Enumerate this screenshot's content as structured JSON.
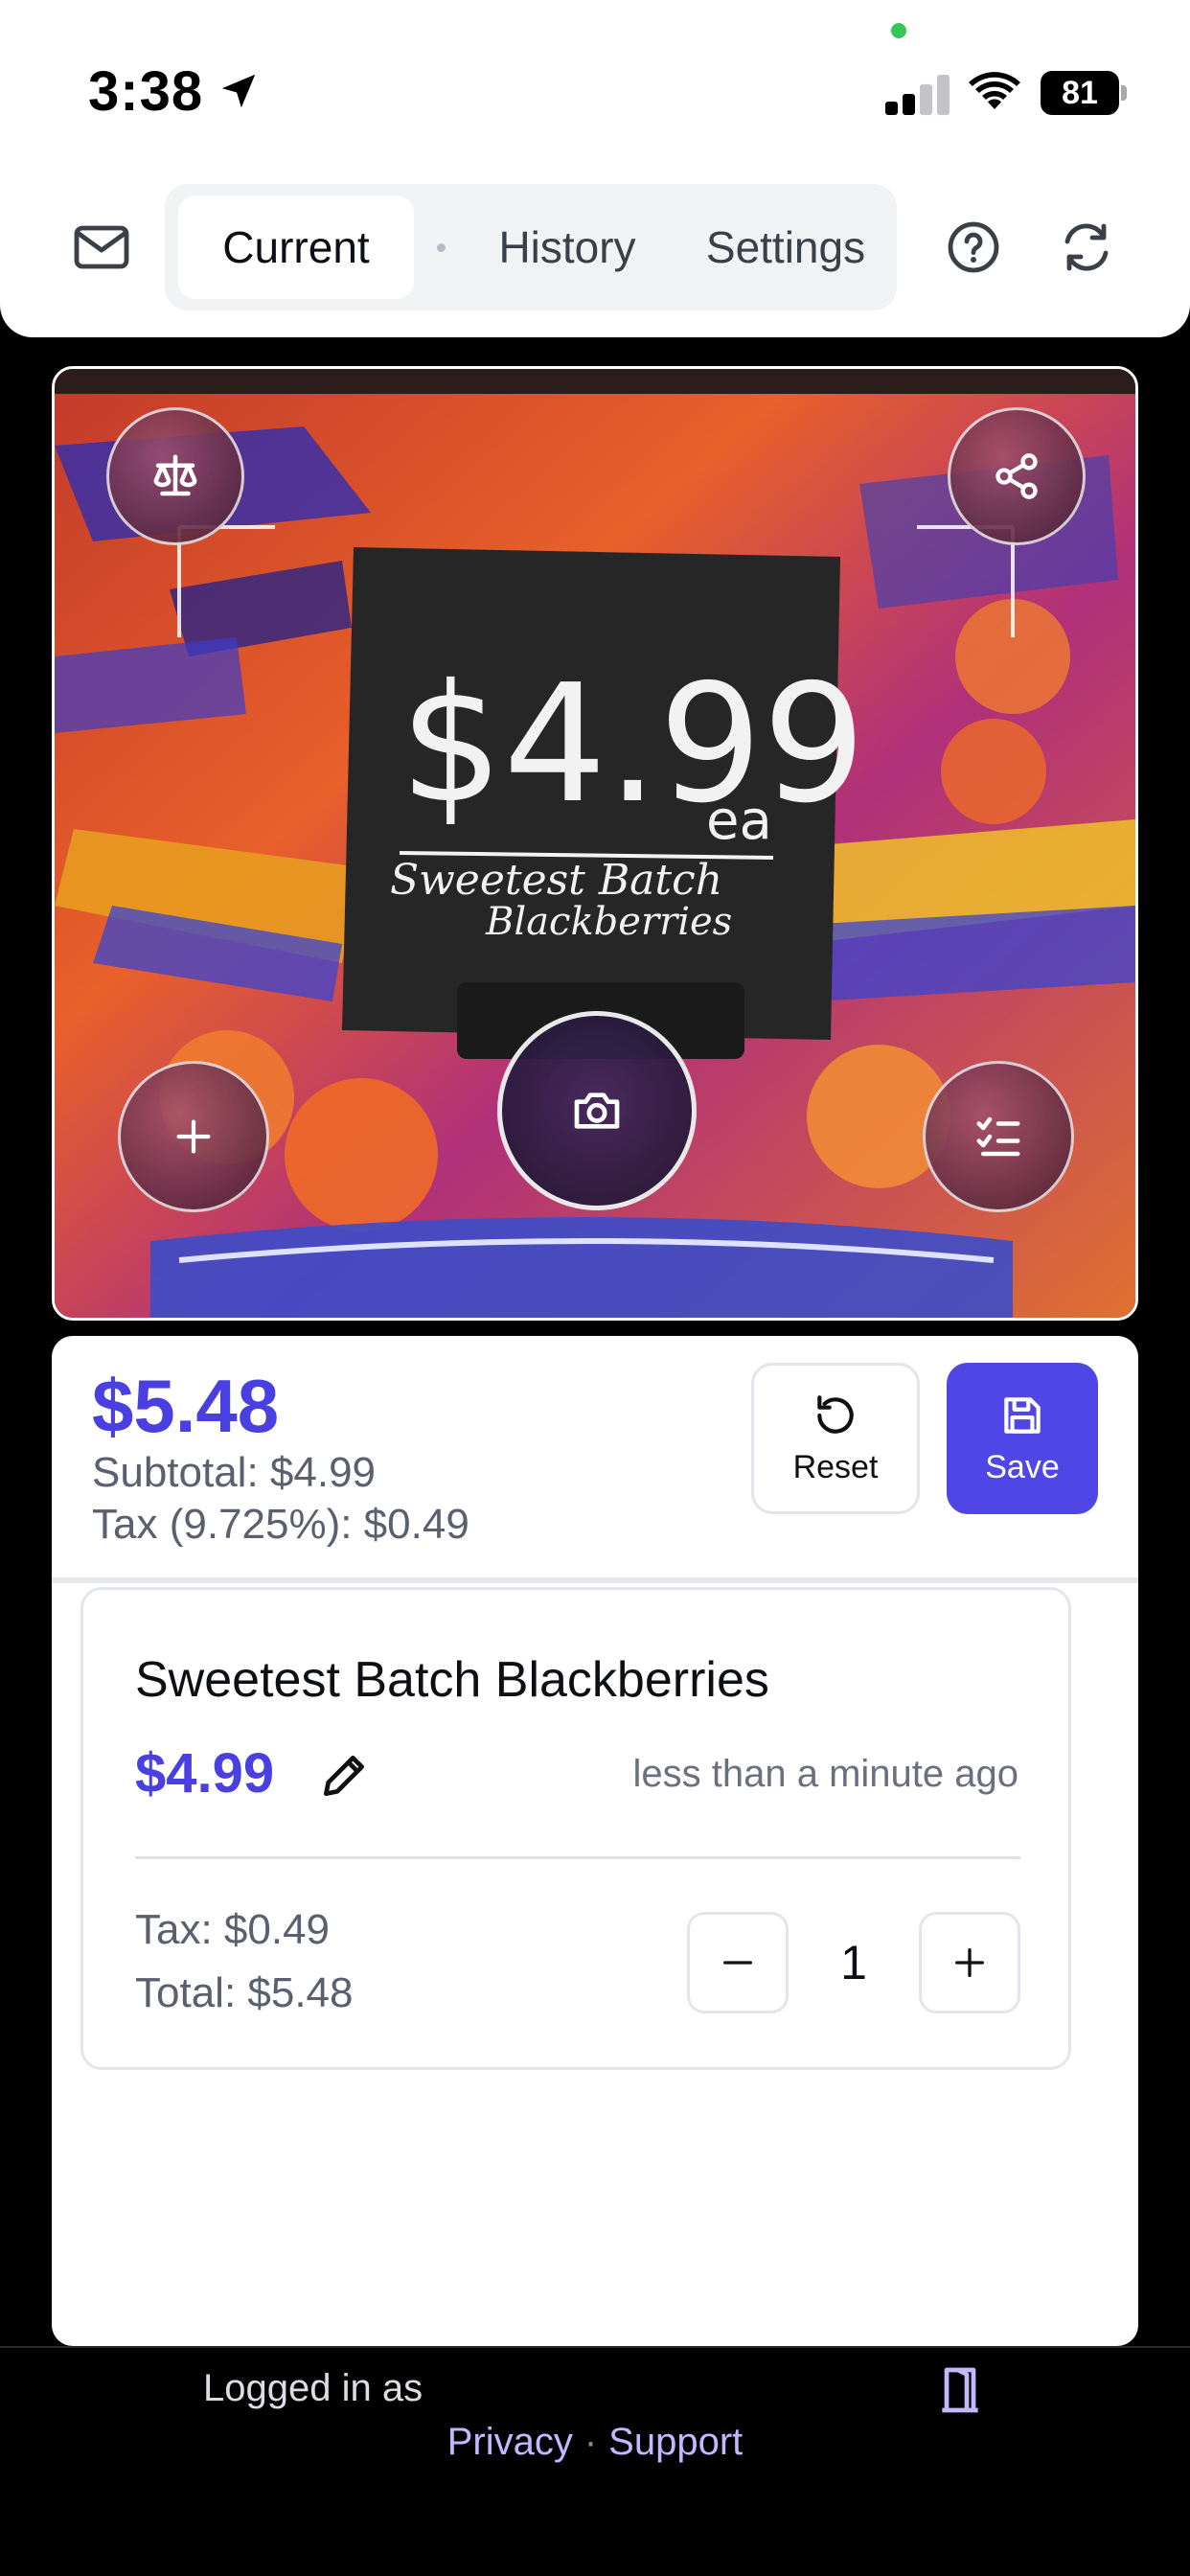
{
  "status_bar": {
    "time": "3:38",
    "battery": "81"
  },
  "tabs": {
    "current": "Current",
    "history": "History",
    "settings": "Settings"
  },
  "camera": {
    "sign_price": "$4.99",
    "sign_unit": "ea",
    "sign_line1": "Sweetest Batch",
    "sign_line2": "Blackberries"
  },
  "summary": {
    "grand_total": "$5.48",
    "subtotal": "Subtotal: $4.99",
    "tax": "Tax (9.725%): $0.49",
    "reset_label": "Reset",
    "save_label": "Save"
  },
  "item": {
    "name": "Sweetest Batch Blackberries",
    "price": "$4.99",
    "time": "less than a minute ago",
    "tax": "Tax: $0.49",
    "total": "Total: $5.48",
    "quantity": "1"
  },
  "footer": {
    "logged_in": "Logged in as",
    "privacy": "Privacy",
    "separator": "·",
    "support": "Support"
  },
  "colors": {
    "accent": "#4f46e5",
    "price": "#4a3fe0",
    "link": "#c2b8ff"
  },
  "icons": [
    "mail-icon",
    "help-icon",
    "refresh-icon",
    "scale-icon",
    "share-icon",
    "plus-icon",
    "camera-icon",
    "checklist-icon",
    "reset-icon",
    "save-icon",
    "pencil-icon",
    "minus-icon",
    "logout-icon"
  ]
}
